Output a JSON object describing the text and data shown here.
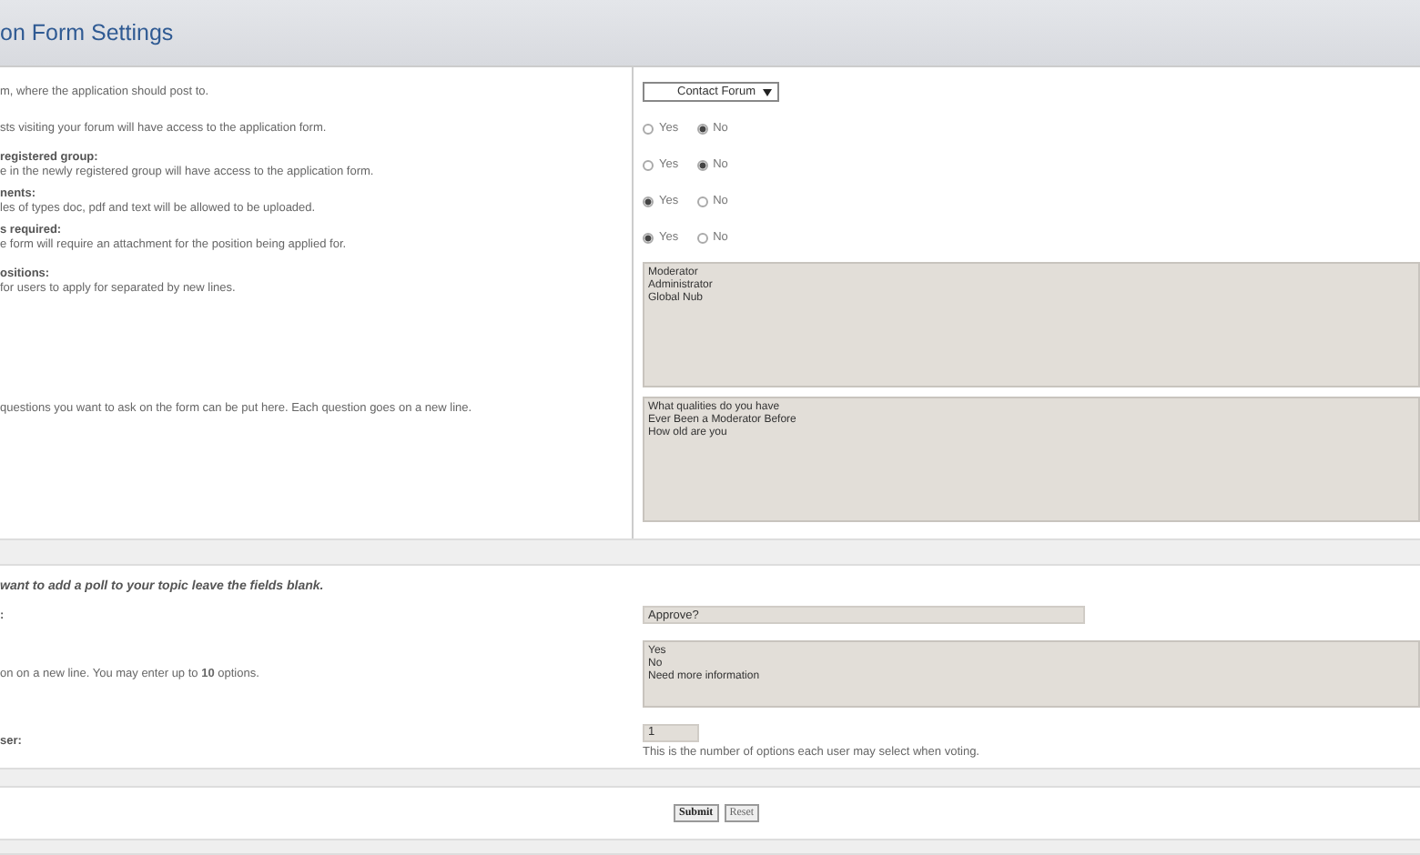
{
  "page_title": "on Form Settings",
  "settings": [
    {
      "kind": "select",
      "description": "m, where the application should post to.",
      "value": "Contact Forum"
    },
    {
      "kind": "radio",
      "description": "sts visiting your forum will have access to the application form.",
      "options": [
        {
          "label": "Yes",
          "selected": false
        },
        {
          "label": "No",
          "selected": true
        }
      ]
    },
    {
      "kind": "radio",
      "title": "registered group:",
      "description": "e in the newly registered group will have access to the application form.",
      "options": [
        {
          "label": "Yes",
          "selected": false
        },
        {
          "label": "No",
          "selected": true
        }
      ]
    },
    {
      "kind": "radio",
      "title": "nents:",
      "description": "les of types doc, pdf and text will be allowed to be uploaded.",
      "options": [
        {
          "label": "Yes",
          "selected": true
        },
        {
          "label": "No",
          "selected": false
        }
      ]
    },
    {
      "kind": "radio",
      "title": "s required:",
      "description": "e form will require an attachment for the position being applied for.",
      "options": [
        {
          "label": "Yes",
          "selected": true
        },
        {
          "label": "No",
          "selected": false
        }
      ]
    },
    {
      "kind": "textarea",
      "title": "ositions:",
      "description": " for users to apply for separated by new lines.",
      "lines": [
        "Moderator",
        "Administrator",
        "Global Nub"
      ]
    },
    {
      "kind": "textarea",
      "description": "questions you want to ask on the form can be put here. Each question goes on a new line.",
      "lines": [
        "What qualities do you have",
        "Ever Been a Moderator Before",
        "How old are you"
      ]
    }
  ],
  "poll": {
    "note": "want to add a poll to your topic leave the fields blank.",
    "rows": [
      {
        "kind": "text",
        "title": ":",
        "value": "Approve?"
      },
      {
        "kind": "textarea",
        "description": "on on a new line. You may enter up to **10** options.",
        "lines": [
          "Yes",
          "No",
          "Need more information"
        ]
      },
      {
        "kind": "number",
        "title": "ser:",
        "value": "1",
        "help": "This is the number of options each user may select when voting."
      }
    ]
  },
  "buttons": [
    {
      "label": "Submit",
      "kind": "primary"
    },
    {
      "label": "Reset",
      "kind": "secondary"
    }
  ]
}
